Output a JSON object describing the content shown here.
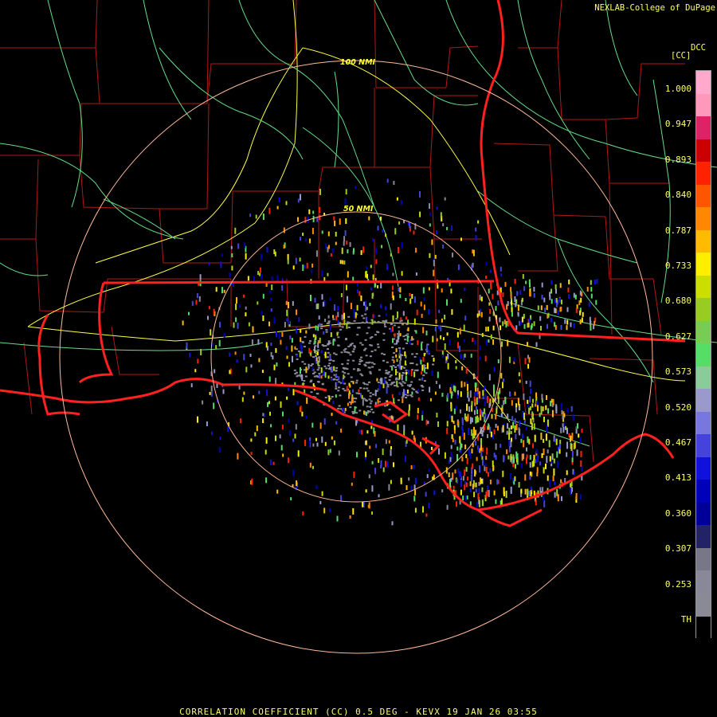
{
  "credit": "NEXLAB-College of DuPage",
  "site_id": "DCC",
  "unit": "[CC]",
  "footer": "CORRELATION COEFFICIENT (CC) 0.5 DEG - KEVX 19 JAN 26 03:55",
  "rings": {
    "inner_label": "50 NMI",
    "outer_label": "100 NMI"
  },
  "colors": {
    "state_border": "#ff2020",
    "county_border": "#b01818",
    "highway": "#ffff44",
    "road": "#66dd88",
    "range_ring": "#ffbb99",
    "label": "#ffff66"
  },
  "legend": {
    "ticks": [
      "1.000",
      "0.947",
      "0.893",
      "0.840",
      "0.787",
      "0.733",
      "0.680",
      "0.627",
      "0.573",
      "0.520",
      "0.467",
      "0.413",
      "0.360",
      "0.307",
      "0.253",
      "TH"
    ],
    "scale_colors": [
      "#ffaacc",
      "#ff99bb",
      "#dd2266",
      "#cc0000",
      "#ff2200",
      "#ff5500",
      "#ff8800",
      "#ffbb00",
      "#ffee00",
      "#ccdd00",
      "#99cc22",
      "#77cc55",
      "#55dd66",
      "#88cc99",
      "#9999cc",
      "#7777dd",
      "#4444dd",
      "#1111dd",
      "#0000bb",
      "#000099",
      "#222266",
      "#777788",
      "#888899",
      "#8a8a96",
      "#000000"
    ]
  }
}
